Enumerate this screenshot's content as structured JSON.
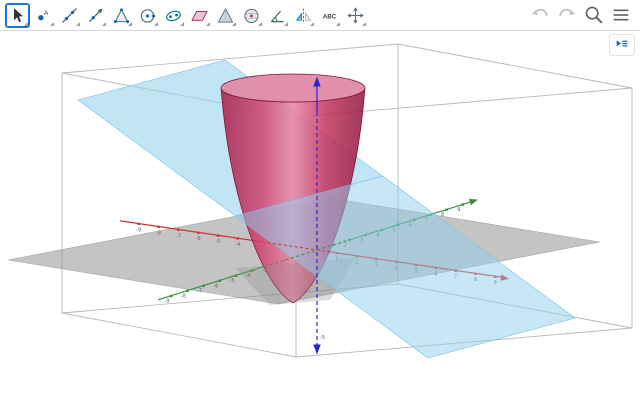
{
  "toolbar": {
    "selected_tool": "move",
    "tools": [
      {
        "id": "move",
        "icon": "cursor-icon"
      },
      {
        "id": "point",
        "icon": "point-icon",
        "glyph_text": "A"
      },
      {
        "id": "line",
        "icon": "line-icon"
      },
      {
        "id": "special-line",
        "icon": "ray-icon"
      },
      {
        "id": "polygon",
        "icon": "polygon-icon"
      },
      {
        "id": "circle",
        "icon": "circle-icon"
      },
      {
        "id": "conic",
        "icon": "ellipse-icon"
      },
      {
        "id": "plane",
        "icon": "plane-icon"
      },
      {
        "id": "pyramid",
        "icon": "pyramid-icon"
      },
      {
        "id": "sphere",
        "icon": "sphere-icon"
      },
      {
        "id": "angle",
        "icon": "angle-icon"
      },
      {
        "id": "reflect",
        "icon": "reflect-icon"
      },
      {
        "id": "text",
        "icon": "text-icon",
        "glyph_text": "ABC"
      },
      {
        "id": "move-view",
        "icon": "move-view-icon"
      }
    ],
    "actions": [
      {
        "id": "undo",
        "icon": "undo-icon",
        "enabled": false
      },
      {
        "id": "redo",
        "icon": "redo-icon",
        "enabled": false
      },
      {
        "id": "zoom",
        "icon": "magnifier-icon",
        "enabled": true
      },
      {
        "id": "menu",
        "icon": "menu-icon",
        "enabled": true
      }
    ]
  },
  "stylebar": {
    "icon": "style-bar-icon"
  },
  "scene": {
    "background": "#ffffff",
    "clipping_box_color": "#b8b8b8",
    "axes": {
      "x": {
        "color": "#d32f2f",
        "tick_labels": [
          -9,
          -8,
          -7,
          -6,
          -5,
          -4,
          -3,
          -2,
          -1,
          1,
          2,
          3,
          4,
          5,
          6,
          7,
          8,
          9
        ]
      },
      "y": {
        "color": "#388e3c",
        "tick_labels": [
          -9,
          -8,
          -7,
          -6,
          -5,
          -4,
          -3,
          -2,
          -1,
          1,
          2,
          3,
          4,
          5,
          6,
          7,
          8,
          9
        ]
      },
      "z": {
        "color": "#2626d8",
        "tick_labels": [
          -5
        ]
      }
    },
    "objects": [
      {
        "name": "paraboloid",
        "color": "#c73b63"
      },
      {
        "name": "cutting-plane",
        "color": "#8fd0ef"
      },
      {
        "name": "xy-plane",
        "color": "#8a8a8a"
      }
    ]
  }
}
